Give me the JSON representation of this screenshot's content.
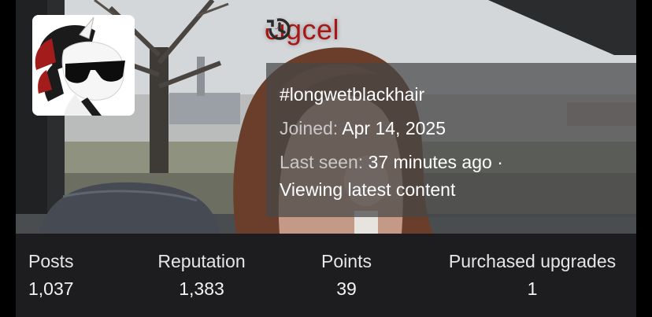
{
  "profile": {
    "username": "cigcel",
    "username_color": "#a81616",
    "custom_title": "#longwetblackhair",
    "joined_label": "Joined:",
    "joined_value": "Apr 14, 2025",
    "last_seen_label": "Last seen:",
    "last_seen_value": "37 minutes ago ·",
    "activity": "Viewing latest content",
    "history_icon": "history-icon",
    "avatar_icon": "pony-avatar"
  },
  "stats": [
    {
      "label": "Posts",
      "value": "1,037"
    },
    {
      "label": "Reputation",
      "value": "1,383"
    },
    {
      "label": "Points",
      "value": "39"
    },
    {
      "label": "Purchased upgrades",
      "value": "1"
    }
  ]
}
